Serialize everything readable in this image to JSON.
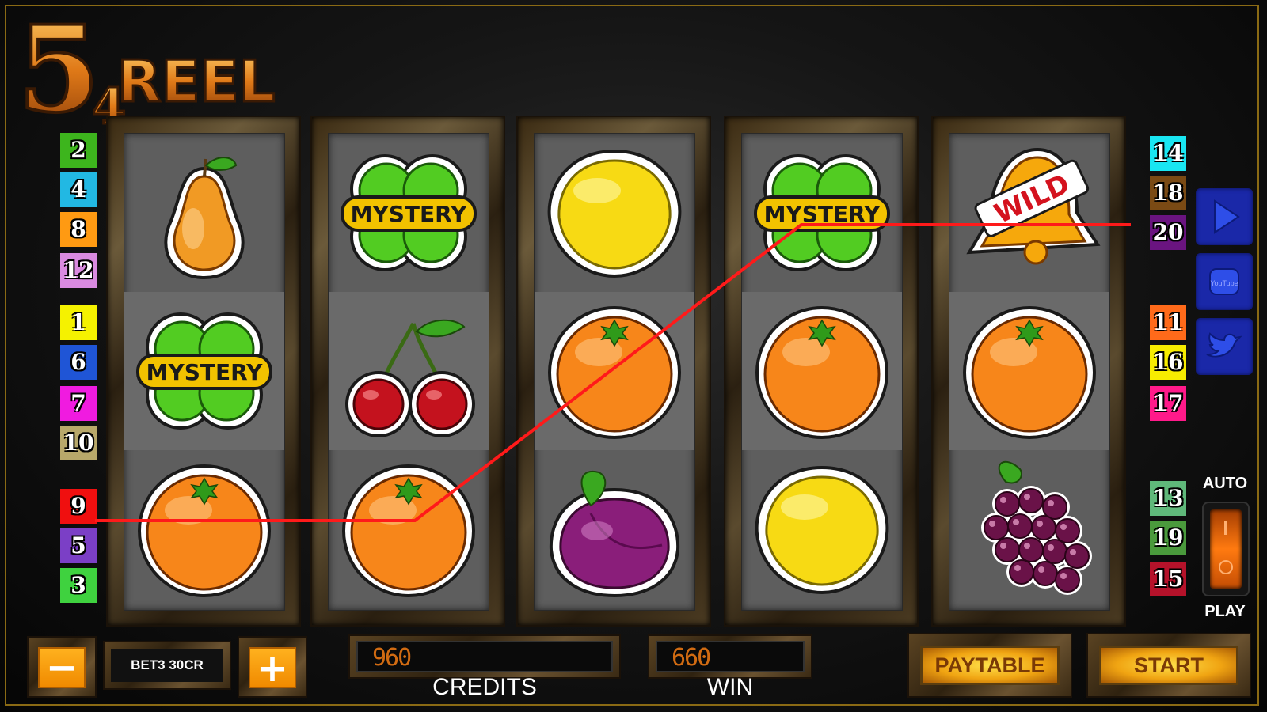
{
  "logo": {
    "big": "5",
    "small": "4",
    "word": "REEL"
  },
  "reels": [
    [
      "pear",
      "clover-mystery",
      "orange"
    ],
    [
      "clover-mystery",
      "cherry",
      "orange"
    ],
    [
      "lemon",
      "orange",
      "plum"
    ],
    [
      "clover-mystery",
      "orange",
      "lemon"
    ],
    [
      "bell-wild",
      "orange",
      "grapes"
    ]
  ],
  "symbol_text": {
    "mystery": "MYSTERY",
    "wild": "WILD"
  },
  "left_lines": [
    {
      "num": "2",
      "color": "#3db51d"
    },
    {
      "num": "4",
      "color": "#22b8e3"
    },
    {
      "num": "8",
      "color": "#ff9a12"
    },
    {
      "num": "12",
      "color": "#d98ae0"
    },
    {
      "num": "1",
      "color": "#f5f200"
    },
    {
      "num": "6",
      "color": "#1f55d6"
    },
    {
      "num": "7",
      "color": "#f01be0"
    },
    {
      "num": "10",
      "color": "#b8a86a"
    },
    {
      "num": "9",
      "color": "#f00f0f"
    },
    {
      "num": "5",
      "color": "#7b3fc6"
    },
    {
      "num": "3",
      "color": "#3fd23f"
    }
  ],
  "right_lines": [
    {
      "num": "14",
      "color": "#19e6f2"
    },
    {
      "num": "18",
      "color": "#7a4a14"
    },
    {
      "num": "20",
      "color": "#6a1480"
    },
    {
      "num": "11",
      "color": "#ff6a1a"
    },
    {
      "num": "16",
      "color": "#f7ec00"
    },
    {
      "num": "17",
      "color": "#ff1a8a"
    },
    {
      "num": "13",
      "color": "#5fb87a"
    },
    {
      "num": "19",
      "color": "#4a9a3c"
    },
    {
      "num": "15",
      "color": "#b5122a"
    }
  ],
  "active_line": {
    "num": "9",
    "color": "#ff1a1a"
  },
  "social": [
    "play-store-icon",
    "youtube-icon",
    "twitter-icon"
  ],
  "youtube_text": "YouTube",
  "auto": {
    "top_label": "AUTO",
    "bottom_label": "PLAY",
    "on": false
  },
  "bet": {
    "minus": "−",
    "plus": "+",
    "label": "BET3 30CR"
  },
  "credits": {
    "value": "960",
    "label": "CREDITS"
  },
  "win": {
    "value": "660",
    "label": "WIN"
  },
  "buttons": {
    "paytable": "PAYTABLE",
    "start": "START"
  }
}
